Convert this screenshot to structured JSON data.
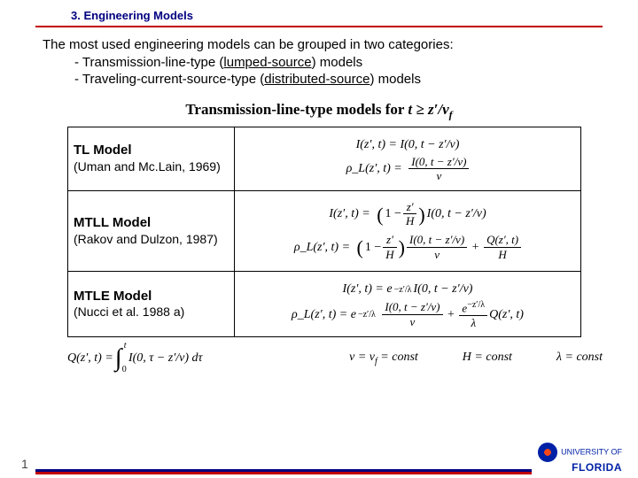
{
  "header": {
    "title": "3. Engineering Models"
  },
  "intro": {
    "line1": "The most used engineering models can be grouped in two categories:",
    "bullet1a": "- Transmission-line-type (",
    "bullet1b": "lumped-source",
    "bullet1c": ") models",
    "bullet2a": "- Traveling-current-source-type (",
    "bullet2b": "distributed-source",
    "bullet2c": ") models"
  },
  "subtitle": {
    "prefix": "Transmission-line-type models for ",
    "cond": "t ≥ z′/v",
    "sub": "f"
  },
  "models": [
    {
      "title": "TL Model",
      "cite": "(Uman and Mc.Lain, 1969)",
      "eqI": "I(z′, t) = I(0, t − z′/ν)",
      "eqRho_lhs": "ρ_L(z′, t) =",
      "eqRho_num": "I(0, t − z′/ν)",
      "eqRho_den": "ν"
    },
    {
      "title": "MTLL Model",
      "cite": "(Rakov and Dulzon, 1987)",
      "eqI_lhs": "I(z′, t) =",
      "eqI_fac_num": "z′",
      "eqI_fac_den": "H",
      "eqI_rest": "I(0, t − z′/ν)",
      "eqRho_lhs": "ρ_L(z′, t) =",
      "eqRho_fac_num": "z′",
      "eqRho_fac_den": "H",
      "eqRho_t1_num": "I(0, t − z′/ν)",
      "eqRho_t1_den": "ν",
      "eqRho_t2_num": "Q(z′, t)",
      "eqRho_t2_den": "H"
    },
    {
      "title": "MTLE Model",
      "cite": "(Nucci et al. 1988 a)",
      "eqI_lhs": "I(z′, t) = e",
      "eqI_exp": "−z′/λ",
      "eqI_rest": " I(0, t − z′/ν)",
      "eqRho_lhs": "ρ_L(z′, t) = e",
      "eqRho_exp": "−z′/λ",
      "eqRho_t1_num": "I(0, t − z′/ν)",
      "eqRho_t1_den": "ν",
      "eqRho_t2_pre": "e",
      "eqRho_t2_exp": "−z′/λ",
      "eqRho_t2_den": "λ",
      "eqRho_t2_rest": "Q(z′, t)"
    }
  ],
  "bottom": {
    "Qdef_lhs": "Q(z′, t) =",
    "Qdef_upper": "t",
    "Qdef_lower": "0",
    "Qdef_int": "I(0, τ − z′/ν) dτ",
    "c1": "ν = v_f = const",
    "c2": "H = const",
    "c3": "λ = const"
  },
  "page": "1",
  "logo": {
    "small": "UNIVERSITY OF",
    "big": "FLORIDA"
  }
}
